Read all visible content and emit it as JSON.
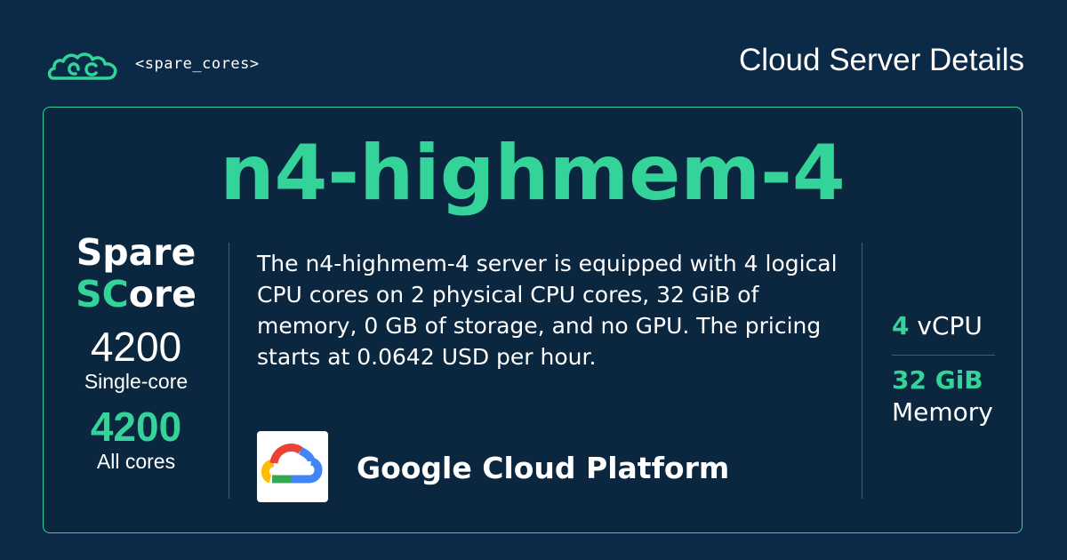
{
  "header": {
    "brand_text": "<spare_cores>",
    "page_heading": "Cloud Server Details"
  },
  "server": {
    "name": "n4-highmem-4",
    "description": "The n4-highmem-4 server is equipped with 4 logical CPU cores on 2 physical CPU cores, 32 GiB of memory, 0 GB of storage, and no GPU. The pricing starts at 0.0642 USD per hour."
  },
  "score": {
    "title_line1": "Spare",
    "title_sc": "SC",
    "title_rest": "ore",
    "single_core_value": "4200",
    "single_core_label": "Single-core",
    "all_cores_value": "4200",
    "all_cores_label": "All cores"
  },
  "vendor": {
    "name": "Google Cloud Platform",
    "logo_icon": "google-cloud-logo-icon"
  },
  "specs": {
    "vcpu_value": "4",
    "vcpu_unit": " vCPU",
    "memory_value": "32 GiB",
    "memory_label": "Memory"
  },
  "colors": {
    "background": "#0a2a47",
    "card": "#0b263f",
    "accent": "#34d399",
    "divider": "#3e5e7e"
  }
}
